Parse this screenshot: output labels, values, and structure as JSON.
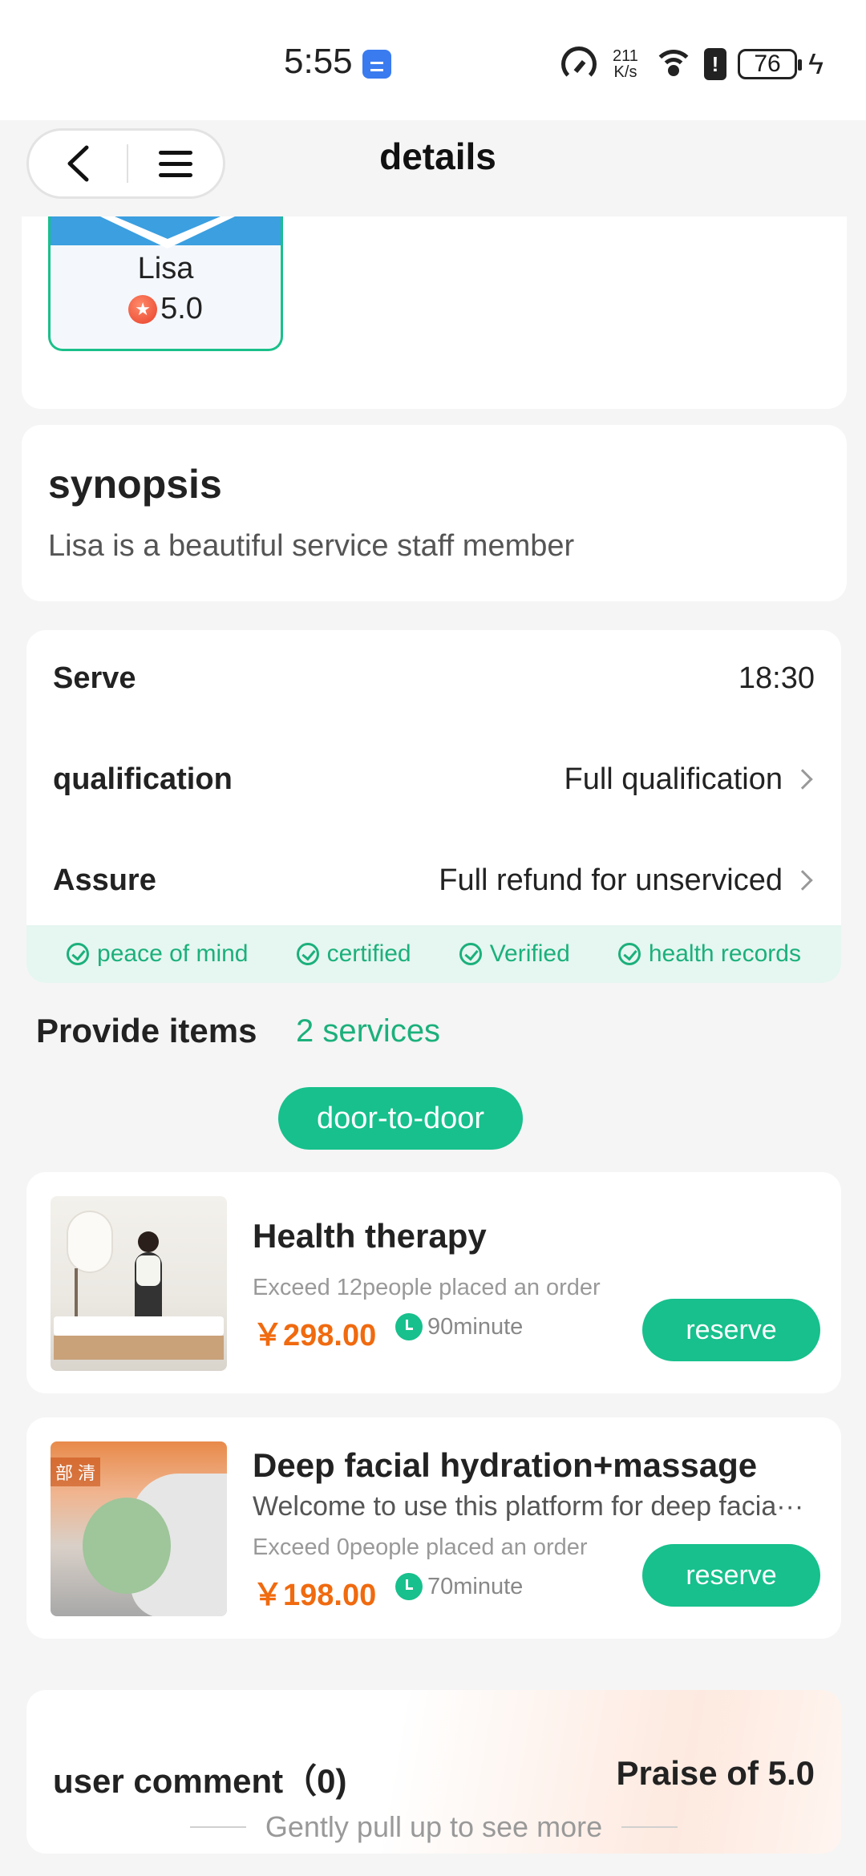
{
  "status_bar": {
    "time": "5:55",
    "net_speed_value": "211",
    "net_speed_unit": "K/s",
    "battery": "76",
    "icons": [
      "usb-icon",
      "speedometer-icon",
      "wifi-icon",
      "battery-alert-icon",
      "battery-icon",
      "charging-bolt-icon"
    ]
  },
  "nav": {
    "title": "details",
    "back_icon": "chevron-left-icon",
    "menu_icon": "hamburger-menu-icon"
  },
  "staff": {
    "name": "Lisa",
    "rating": "5.0"
  },
  "synopsis": {
    "title": "synopsis",
    "text": "Lisa is a beautiful service staff member"
  },
  "info": {
    "rows": [
      {
        "label": "Serve",
        "value": "18:30"
      },
      {
        "label": "qualification",
        "value": "Full qualification"
      },
      {
        "label": "Assure",
        "value": "Full refund for unserviced"
      }
    ],
    "badges": [
      "peace of mind",
      "certified",
      "Verified",
      "health records"
    ]
  },
  "provide": {
    "title": "Provide items",
    "count": "2 services",
    "filter": "door-to-door"
  },
  "services": [
    {
      "name": "Health therapy",
      "desc": "",
      "orders": "Exceed 12people placed an order",
      "price": "￥298.00",
      "duration": "90minute",
      "button": "reserve"
    },
    {
      "name": "Deep facial hydration+massage",
      "desc": "Welcome to use this platform for deep facia···",
      "orders": "Exceed 0people placed an order",
      "price": "￥198.00",
      "duration": "70minute",
      "button": "reserve",
      "thumb_text": "部 清"
    }
  ],
  "comments": {
    "title": "user comment（0)",
    "praise": "Praise of 5.0",
    "hint": "Gently pull up to see more"
  },
  "colors": {
    "accent_green": "#17c08c",
    "price_orange": "#f06a0f",
    "card_border_green": "#19c08a"
  }
}
